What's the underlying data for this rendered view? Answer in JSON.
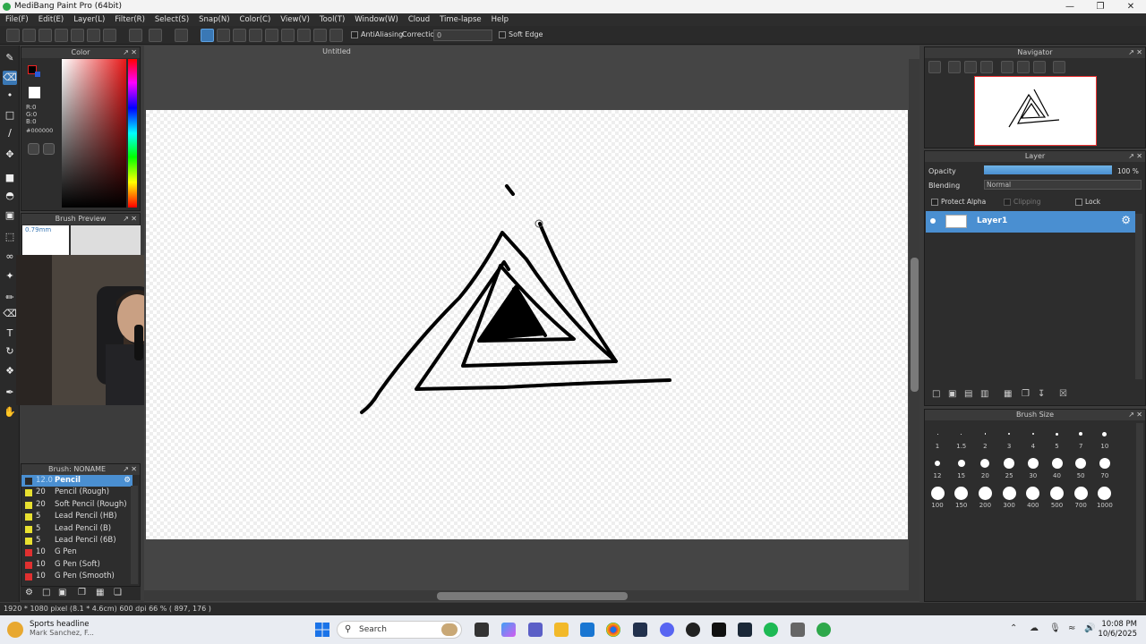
{
  "window": {
    "title": "MediBang Paint Pro (64bit)"
  },
  "menu": [
    "File(F)",
    "Edit(E)",
    "Layer(L)",
    "Filter(R)",
    "Select(S)",
    "Snap(N)",
    "Color(C)",
    "View(V)",
    "Tool(T)",
    "Window(W)",
    "Cloud",
    "Time-lapse",
    "Help"
  ],
  "toolbar": {
    "antialias_label": "AntiAliasing",
    "correction_label": "Correction",
    "correction_value": "0",
    "soft_edge_label": "Soft Edge"
  },
  "color_panel": {
    "title": "Color",
    "r": "R:0",
    "g": "G:0",
    "b": "B:0",
    "hex": "#000000"
  },
  "brush_preview": {
    "title": "Brush Preview",
    "size": "0.79mm"
  },
  "brush_panel": {
    "title": "Brush: NONAME",
    "items": [
      {
        "size": "12.0",
        "name": "Pencil",
        "color": "#2a2a2a"
      },
      {
        "size": "20",
        "name": "Pencil (Rough)",
        "color": "#e8e030"
      },
      {
        "size": "20",
        "name": "Soft Pencil (Rough)",
        "color": "#e8e030"
      },
      {
        "size": "5",
        "name": "Lead Pencil (HB)",
        "color": "#e8e030"
      },
      {
        "size": "5",
        "name": "Lead Pencil (B)",
        "color": "#e8e030"
      },
      {
        "size": "5",
        "name": "Lead Pencil (6B)",
        "color": "#e8e030"
      },
      {
        "size": "10",
        "name": "G Pen",
        "color": "#e03030"
      },
      {
        "size": "10",
        "name": "G Pen (Soft)",
        "color": "#e03030"
      },
      {
        "size": "10",
        "name": "G Pen (Smooth)",
        "color": "#e03030"
      }
    ]
  },
  "document": {
    "title": "Untitled"
  },
  "navigator": {
    "title": "Navigator"
  },
  "layer_panel": {
    "title": "Layer",
    "opacity_label": "Opacity",
    "opacity_value": "100 %",
    "blending_label": "Blending",
    "blending_value": "Normal",
    "protect_alpha": "Protect Alpha",
    "clipping": "Clipping",
    "lock": "Lock",
    "layers": [
      {
        "name": "Layer1"
      }
    ]
  },
  "brush_size_panel": {
    "title": "Brush Size",
    "sizes": [
      "1",
      "1.5",
      "2",
      "3",
      "4",
      "5",
      "7",
      "10",
      "12",
      "15",
      "20",
      "25",
      "30",
      "40",
      "50",
      "70",
      "100",
      "150",
      "200",
      "300",
      "400",
      "500",
      "700",
      "1000"
    ]
  },
  "status": {
    "text": "1920 * 1080 pixel  (8.1 * 4.6cm)  600 dpi  66 %  ( 897, 176 )"
  },
  "taskbar": {
    "news_title": "Sports headline",
    "news_sub": "Mark Sanchez, F...",
    "search_placeholder": "Search",
    "time": "10:08 PM",
    "date": "10/6/2025"
  },
  "colors": {
    "accent": "#4a8fd1",
    "panel": "#2d2d2d",
    "canvas": "#ffffff"
  }
}
